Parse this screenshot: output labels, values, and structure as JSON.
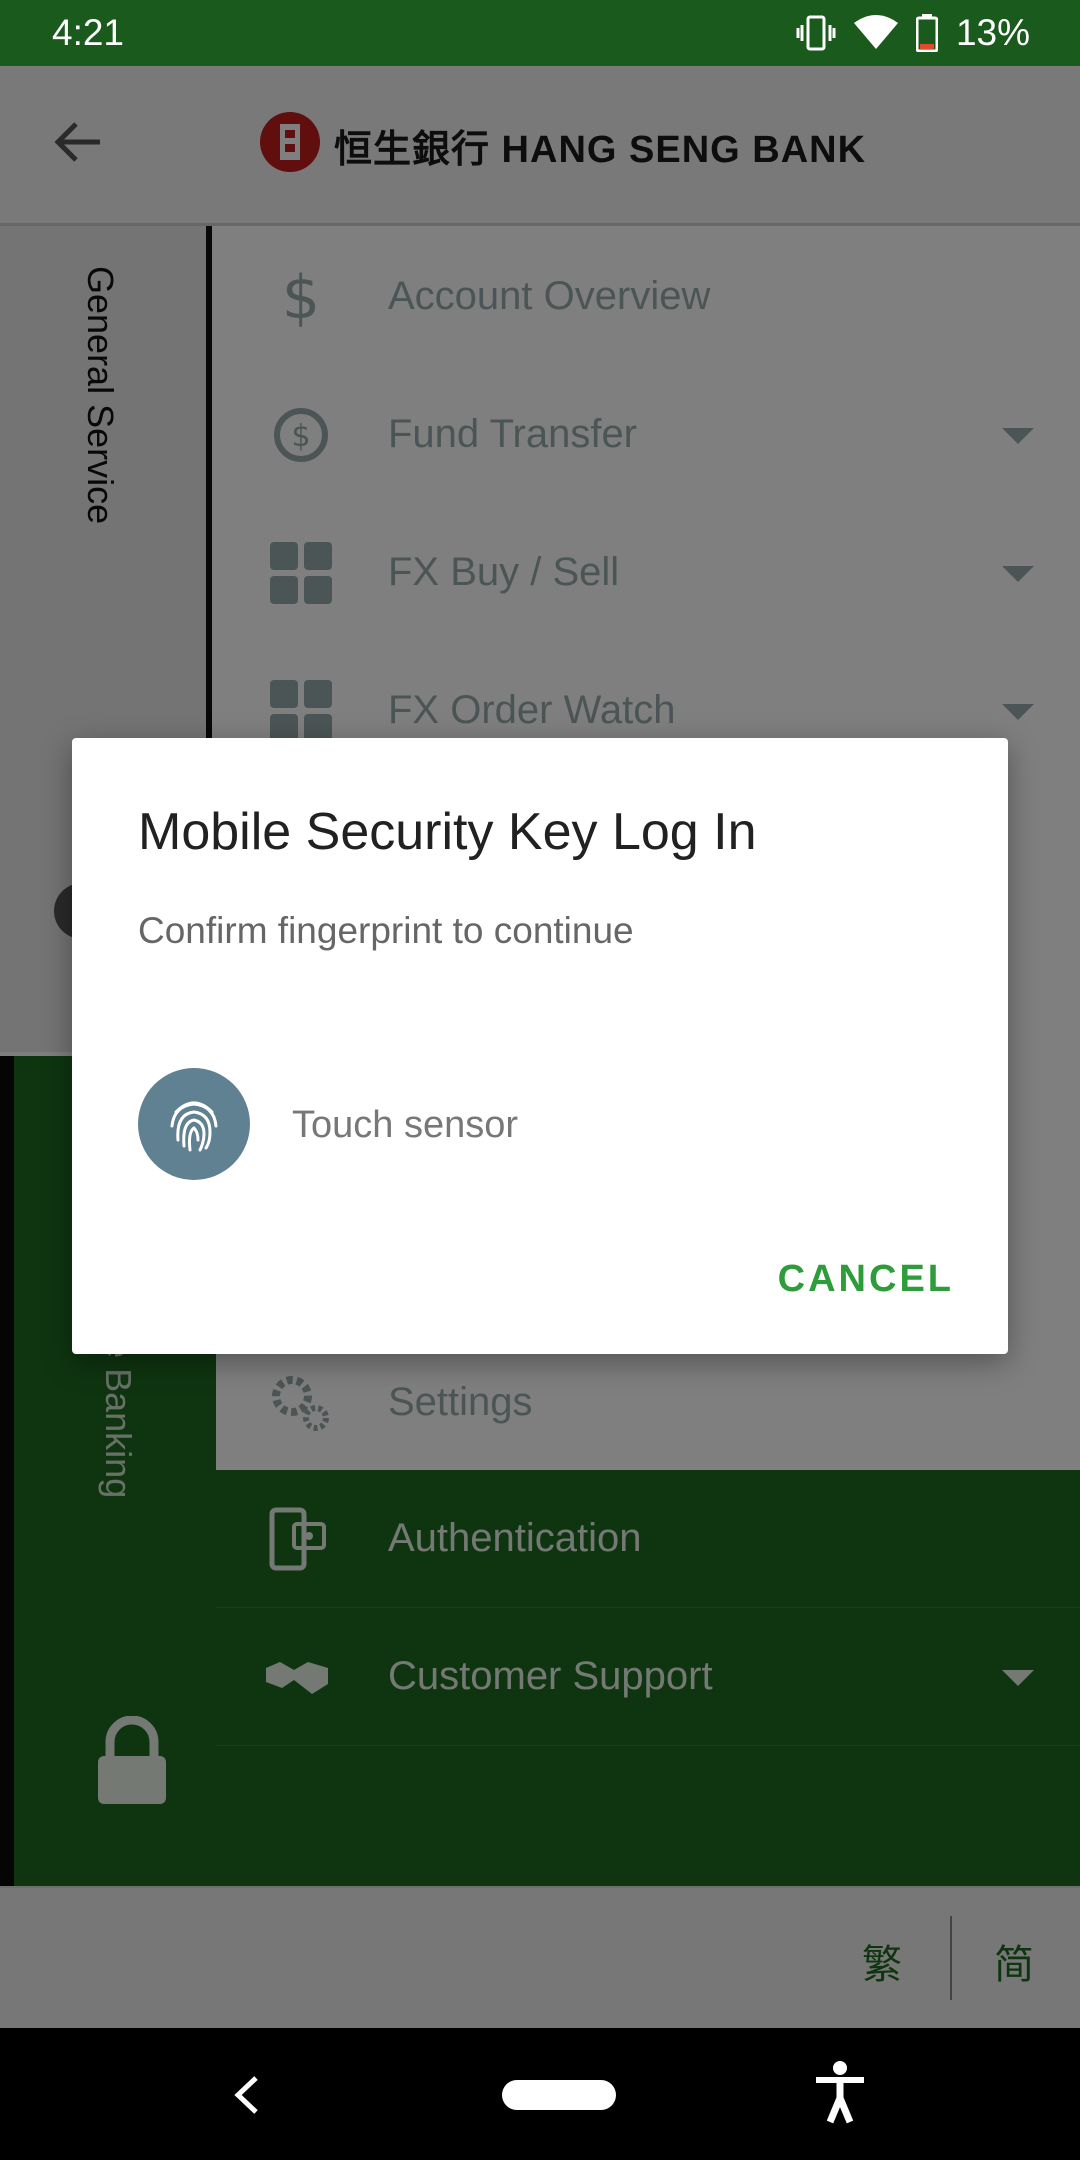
{
  "status_bar": {
    "time": "4:21",
    "battery": "13%"
  },
  "header": {
    "bank_name": "恒生銀行 HANG SENG BANK"
  },
  "sidebar": {
    "general_label": "General Service",
    "business_label": "Business Mobile Banking"
  },
  "menu": {
    "items": [
      {
        "label": "Account Overview",
        "icon": "dollar-icon",
        "has_caret": false
      },
      {
        "label": "Fund Transfer",
        "icon": "transfer-icon",
        "has_caret": true
      },
      {
        "label": "FX Buy / Sell",
        "icon": "fx-icon",
        "has_caret": true
      },
      {
        "label": "FX Order Watch",
        "icon": "fx-icon",
        "has_caret": true
      },
      {
        "label": "Settings",
        "icon": "gear-icon",
        "has_caret": false
      }
    ],
    "green_items": [
      {
        "label": "Authentication",
        "icon": "phone-key-icon",
        "has_caret": false
      },
      {
        "label": "Customer Support",
        "icon": "handshake-icon",
        "has_caret": true
      }
    ]
  },
  "language": {
    "traditional": "繁",
    "simplified": "简"
  },
  "dialog": {
    "title": "Mobile Security Key Log In",
    "subtitle": "Confirm fingerprint to continue",
    "sensor_label": "Touch sensor",
    "cancel_label": "CANCEL"
  },
  "colors": {
    "brand_green": "#1f6b20",
    "status_green": "#1a5a1c",
    "accent_green": "#2e9c3a",
    "fingerprint_blue": "#5f8191"
  }
}
